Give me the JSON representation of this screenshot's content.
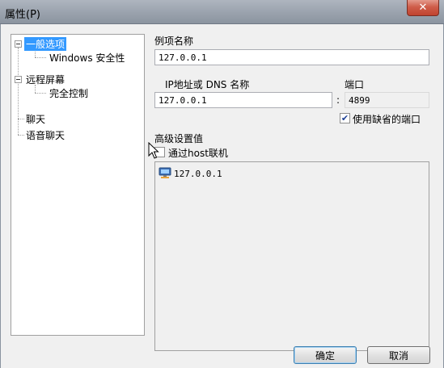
{
  "window": {
    "title": "属性(P)",
    "close_glyph": "✕"
  },
  "tree": {
    "items": [
      {
        "label": "一般选项",
        "selected": true
      },
      {
        "label": "Windows 安全性"
      },
      {
        "label": "远程屏幕"
      },
      {
        "label": "完全控制"
      },
      {
        "label": "聊天"
      },
      {
        "label": "语音聊天"
      }
    ]
  },
  "form": {
    "entry_name_label": "例项名称",
    "entry_name_value": "127.0.0.1",
    "ip_label": "IP地址或 DNS 名称",
    "ip_value": "127.0.0.1",
    "port_label": "端口",
    "port_separator": ":",
    "port_value": "4899",
    "default_port_label": "使用缺省的端口",
    "default_port_checked": true,
    "advanced_label": "高级设置值",
    "via_host_label": "通过host联机",
    "via_host_checked": false,
    "list_items": [
      "127.0.0.1"
    ]
  },
  "buttons": {
    "ok_label": "确定",
    "cancel_label": "取消"
  },
  "colors": {
    "selection": "#3399ff",
    "close_button": "#c9503d",
    "titlebar": "#9aa2ad"
  }
}
